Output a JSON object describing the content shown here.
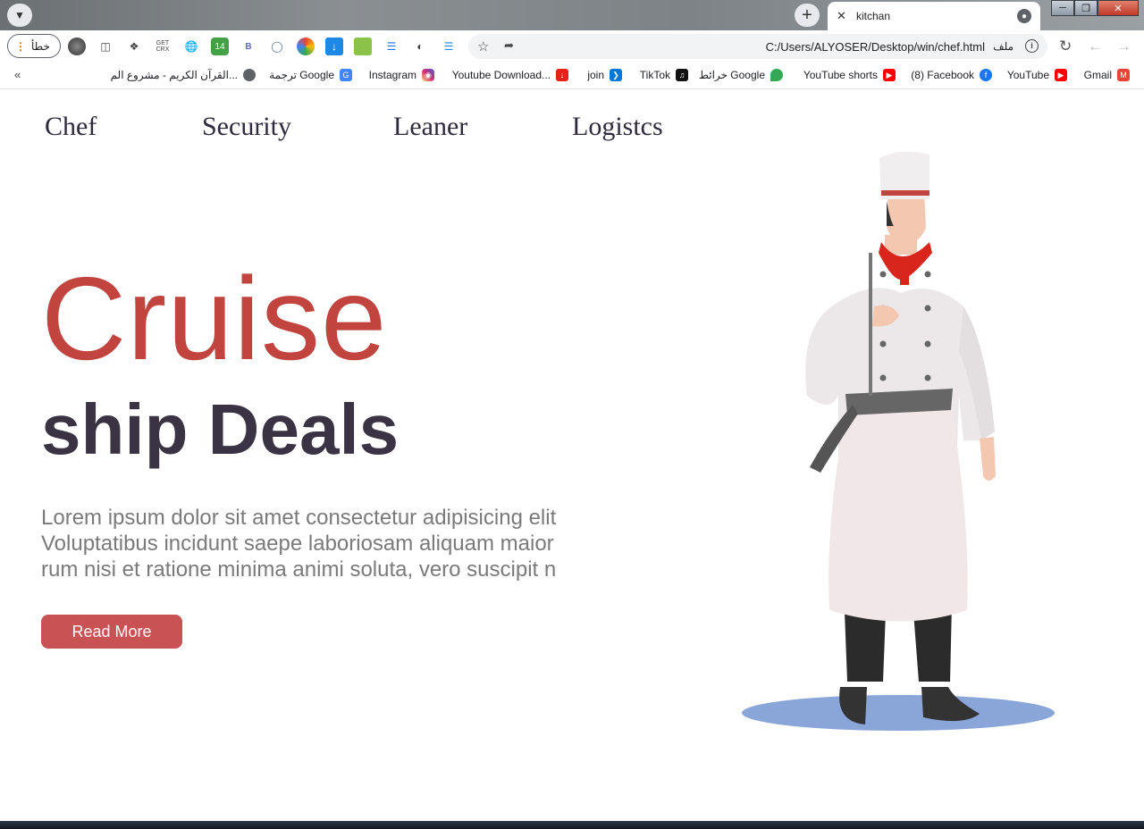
{
  "browser": {
    "tab_title": "kitchan",
    "profile_label": "خطأ",
    "url": "C:/Users/ALYOSER/Desktop/win/chef.html",
    "url_scheme_label": "ملف",
    "extensions": [
      "GET CRX",
      "14",
      "B"
    ],
    "bookmarks": [
      {
        "label": "Gmail",
        "icon": "gmail-icon",
        "color": "#ea4335"
      },
      {
        "label": "YouTube",
        "icon": "youtube-icon",
        "color": "#ff0000"
      },
      {
        "label": "(8) Facebook",
        "icon": "facebook-icon",
        "color": "#1877f2"
      },
      {
        "label": "YouTube shorts",
        "icon": "youtube-icon",
        "color": "#ff0000"
      },
      {
        "label": "خرائط Google",
        "icon": "maps-icon",
        "color": "#34a853"
      },
      {
        "label": "TikTok",
        "icon": "tiktok-icon",
        "color": "#000000"
      },
      {
        "label": "join",
        "icon": "vscode-icon",
        "color": "#0078d4"
      },
      {
        "label": "Youtube Download...",
        "icon": "download-icon",
        "color": "#e62117"
      },
      {
        "label": "Instagram",
        "icon": "instagram-icon",
        "color": "#d6249f"
      },
      {
        "label": "ترجمة Google",
        "icon": "translate-icon",
        "color": "#4285f4"
      },
      {
        "label": "القرآن الكريم - مشروع الم...",
        "icon": "globe-icon",
        "color": "#5f6368"
      }
    ]
  },
  "site": {
    "nav": [
      "Chef",
      "Security",
      "Leaner",
      "Logistcs"
    ],
    "hero_title": "Cruise",
    "hero_subtitle": "ship Deals",
    "hero_text": [
      "Lorem ipsum dolor sit amet consectetur adipisicing elit",
      "Voluptatibus incidunt saepe laboriosam aliquam maior",
      "rum nisi et ratione minima animi soluta, vero suscipit n"
    ],
    "cta_label": "Read More",
    "colors": {
      "accent": "#c2443e",
      "button": "#c85254",
      "heading": "#3a3344",
      "body_text": "#7a7a7a",
      "shadow": "#8aa6d8"
    }
  }
}
